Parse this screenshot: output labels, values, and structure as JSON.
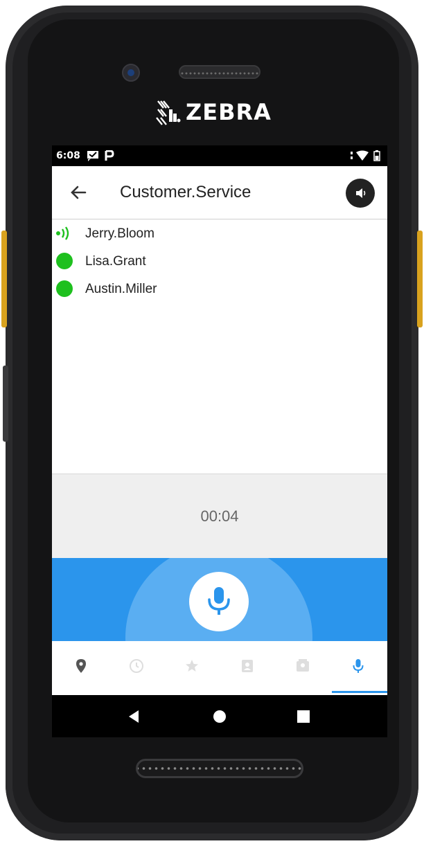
{
  "device": {
    "brand": "ZEBRA"
  },
  "status_bar": {
    "time": "6:08",
    "icons": [
      "message-icon",
      "parking-icon",
      "signal-icon",
      "wifi-icon",
      "battery-icon"
    ]
  },
  "app_bar": {
    "title": "Customer.Service",
    "back_icon": "arrow-left-icon",
    "speaker_icon": "speaker-icon"
  },
  "members": [
    {
      "name": "Jerry.Bloom",
      "status": "talking"
    },
    {
      "name": "Lisa.Grant",
      "status": "online"
    },
    {
      "name": "Austin.Miller",
      "status": "online"
    }
  ],
  "call": {
    "timer": "00:04"
  },
  "tabs": [
    {
      "icon": "location-pin-icon",
      "active": false
    },
    {
      "icon": "history-icon",
      "active": false
    },
    {
      "icon": "star-icon",
      "active": false
    },
    {
      "icon": "contacts-icon",
      "active": false
    },
    {
      "icon": "groups-icon",
      "active": false
    },
    {
      "icon": "microphone-icon",
      "active": true
    }
  ],
  "colors": {
    "accent": "#2b95ec",
    "online": "#1ec01e",
    "halo": "#5aaef2"
  }
}
